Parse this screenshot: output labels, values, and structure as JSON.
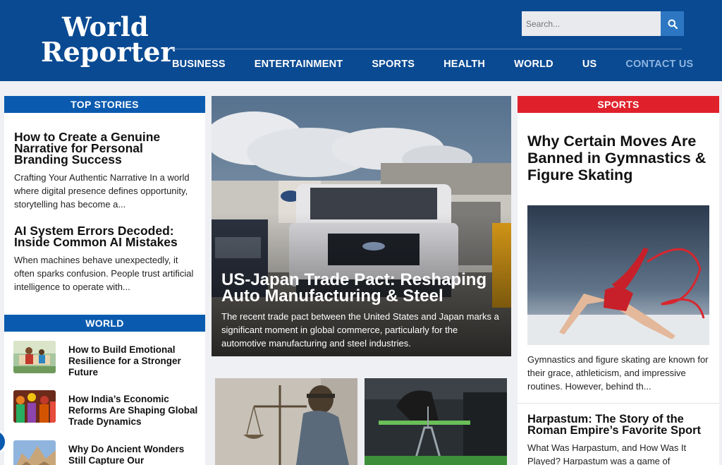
{
  "header": {
    "logo_line1": "World",
    "logo_line2": "Reporter",
    "search_placeholder": "Search...",
    "nav": [
      "BUSINESS",
      "ENTERTAINMENT",
      "SPORTS",
      "HEALTH",
      "WORLD",
      "US",
      "CONTACT US"
    ]
  },
  "top_stories": {
    "heading": "TOP STORIES",
    "items": [
      {
        "title": "How to Create a Genuine Narrative for Personal Branding Success",
        "excerpt": "Crafting Your Authentic Narrative In a world where digital presence defines opportunity, storytelling has become a..."
      },
      {
        "title": "AI System Errors Decoded: Inside Common AI Mistakes",
        "excerpt": "When machines behave unexpectedly, it often sparks confusion. People trust artificial intelligence to operate with..."
      }
    ]
  },
  "world": {
    "heading": "WORLD",
    "items": [
      {
        "title": "How to Build Emotional Resilience for a Stronger Future"
      },
      {
        "title": "How India’s Economic Reforms Are Shaping Global Trade Dynamics"
      },
      {
        "title": "Why Do Ancient Wonders Still Capture Our"
      }
    ]
  },
  "hero": {
    "title": "US-Japan Trade Pact: Reshaping Auto Manufacturing & Steel",
    "description": "The recent trade pact between the United States and Japan marks a significant moment in global commerce, particularly for the automotive manufacturing and steel industries."
  },
  "sports": {
    "heading": "SPORTS",
    "feature_title": "Why Certain Moves Are Banned in Gymnastics & Figure Skating",
    "feature_excerpt": "Gymnastics and figure skating are known for their grace, athleticism, and impressive routines. However, behind th...",
    "second_title": "Harpastum: The Story of the Roman Empire’s Favorite Sport",
    "second_excerpt": "What Was Harpastum, and How Was It Played? Harpastum was a game of"
  },
  "colors": {
    "header_bg": "#0a4a92",
    "section_blue": "#0a5bb0",
    "section_red": "#e0212b",
    "contact_link": "#8db4e0"
  },
  "icons": {
    "search": "search-icon"
  }
}
